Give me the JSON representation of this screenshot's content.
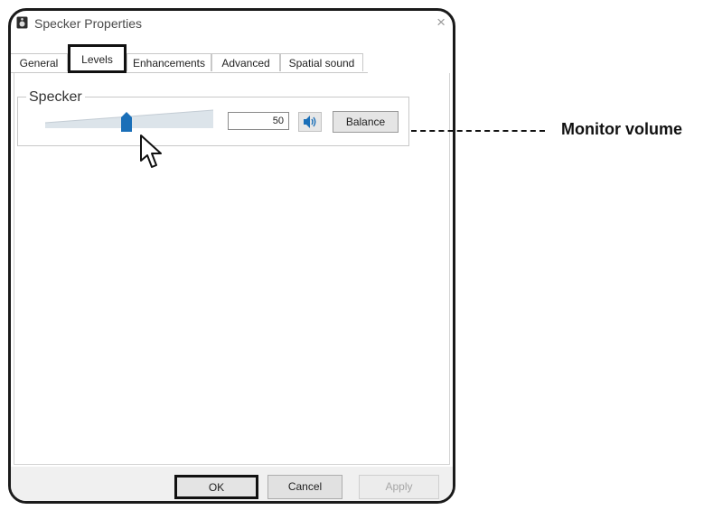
{
  "window": {
    "title": "Specker Properties",
    "close_glyph": "×"
  },
  "tabs": [
    {
      "label": "General",
      "active": false
    },
    {
      "label": "Levels",
      "active": true
    },
    {
      "label": "Enhancements",
      "active": false
    },
    {
      "label": "Advanced",
      "active": false
    },
    {
      "label": "Spatial sound",
      "active": false
    }
  ],
  "levels": {
    "group_label": "Specker",
    "volume_value": "50",
    "volume_fraction": 0.5,
    "speaker_icon": "speaker-volume-icon",
    "balance_label": "Balance"
  },
  "buttons": {
    "ok_label": "OK",
    "cancel_label": "Cancel",
    "apply_label": "Apply"
  },
  "annotation": {
    "text": "Monitor volume"
  },
  "colors": {
    "slider_thumb": "#1a6fb8",
    "speaker_icon": "#1a6fb8",
    "track": "#c9d3dc"
  }
}
